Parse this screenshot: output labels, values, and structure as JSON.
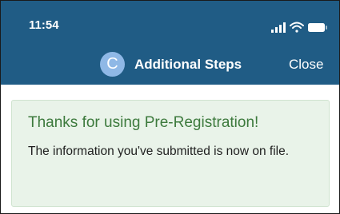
{
  "status_bar": {
    "time": "11:54",
    "icons": [
      "signal-icon",
      "wifi-icon",
      "battery-icon"
    ]
  },
  "nav": {
    "avatar_letter": "C",
    "title": "Additional Steps",
    "close_label": "Close"
  },
  "alert": {
    "title": "Thanks for using Pre-Registration!",
    "message": "The information you've submitted is now on file."
  },
  "colors": {
    "header_background": "#205c85",
    "avatar_background": "#8fb8e6",
    "alert_background": "#e9f3e9",
    "alert_title": "#3d7a3d"
  }
}
